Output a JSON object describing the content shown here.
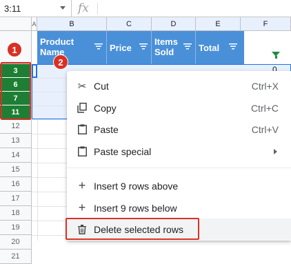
{
  "formula_bar": {
    "cell_ref": "3:11",
    "fx_label": "fx"
  },
  "columns": [
    "A",
    "B",
    "C",
    "D",
    "E",
    "F"
  ],
  "rows": [
    "3",
    "6",
    "7",
    "11",
    "12",
    "13",
    "14",
    "15",
    "16",
    "17",
    "18",
    "19",
    "20",
    "21"
  ],
  "table_headers": [
    {
      "label": "Product Name"
    },
    {
      "label": "Price"
    },
    {
      "label": "Items Sold"
    },
    {
      "label": "Total"
    }
  ],
  "f_cell_value": "0",
  "badges": {
    "step1": "1",
    "step2": "2"
  },
  "menu": {
    "items": [
      {
        "icon": "scissors-icon",
        "label": "Cut",
        "shortcut": "Ctrl+X"
      },
      {
        "icon": "copy-icon",
        "label": "Copy",
        "shortcut": "Ctrl+C"
      },
      {
        "icon": "clipboard-icon",
        "label": "Paste",
        "shortcut": "Ctrl+V"
      },
      {
        "icon": "clipboard-icon",
        "label": "Paste special",
        "shortcut": ""
      },
      {
        "icon": "plus-icon",
        "label": "Insert 9 rows above",
        "shortcut": ""
      },
      {
        "icon": "plus-icon",
        "label": "Insert 9 rows below",
        "shortcut": ""
      },
      {
        "icon": "trash-icon",
        "label": "Delete selected rows",
        "shortcut": ""
      }
    ]
  },
  "colors": {
    "header_blue": "#4a90d9",
    "selected_row_green": "#1e7e34",
    "annotation_red": "#d93025",
    "selection_blue": "#1a73e8"
  }
}
